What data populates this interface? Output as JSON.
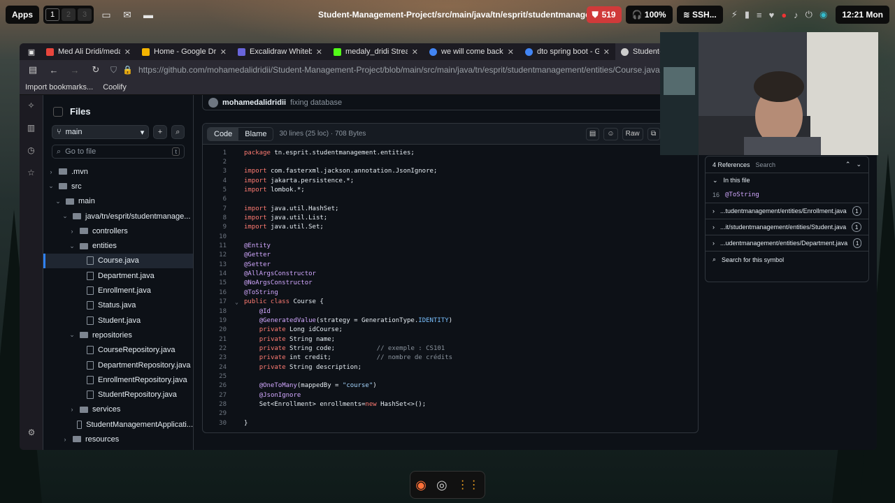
{
  "top_panel": {
    "apps_label": "Apps",
    "workspaces": [
      "1",
      "2",
      "3"
    ],
    "window_title": "Student-Management-Project/src/main/java/tn/esprit/studentmanage...",
    "notification_count": "519",
    "volume": "100%",
    "network": "SSH...",
    "clock": "12:21 Mon"
  },
  "tabs": [
    {
      "label": "Med Ali Dridi/medaly",
      "icon_color": "#e8453c"
    },
    {
      "label": "Home - Google Drive",
      "icon_color": "#f4b400"
    },
    {
      "label": "Excalidraw Whiteboa",
      "icon_color": "#6965db"
    },
    {
      "label": "medaly_dridi Stream",
      "icon_color": "#53fc18"
    },
    {
      "label": "we will come back - G",
      "icon_color": "#4285f4"
    },
    {
      "label": "dto spring boot - Goo",
      "icon_color": "#4285f4"
    },
    {
      "label": "Student-M",
      "icon_color": "#cccccc"
    }
  ],
  "url": "https://github.com/mohamedalidridii/Student-Management-Project/blob/main/src/main/java/tn/esprit/studentmanagement/entities/Course.java",
  "bookmarks": [
    "Import bookmarks...",
    "Coolify"
  ],
  "sidebar": {
    "title": "Files",
    "branch": "main",
    "goto_placeholder": "Go to file",
    "goto_shortcut": "t",
    "tree": [
      {
        "label": ".mvn",
        "type": "folder",
        "depth": 0,
        "state": "collapsed"
      },
      {
        "label": "src",
        "type": "folder",
        "depth": 0,
        "state": "expanded"
      },
      {
        "label": "main",
        "type": "folder",
        "depth": 1,
        "state": "expanded"
      },
      {
        "label": "java/tn/esprit/studentmanage...",
        "type": "folder",
        "depth": 2,
        "state": "expanded"
      },
      {
        "label": "controllers",
        "type": "folder",
        "depth": 3,
        "state": "collapsed"
      },
      {
        "label": "entities",
        "type": "folder",
        "depth": 3,
        "state": "expanded"
      },
      {
        "label": "Course.java",
        "type": "file",
        "depth": 4,
        "selected": true
      },
      {
        "label": "Department.java",
        "type": "file",
        "depth": 4
      },
      {
        "label": "Enrollment.java",
        "type": "file",
        "depth": 4
      },
      {
        "label": "Status.java",
        "type": "file",
        "depth": 4
      },
      {
        "label": "Student.java",
        "type": "file",
        "depth": 4
      },
      {
        "label": "repositories",
        "type": "folder",
        "depth": 3,
        "state": "expanded"
      },
      {
        "label": "CourseRepository.java",
        "type": "file",
        "depth": 4
      },
      {
        "label": "DepartmentRepository.java",
        "type": "file",
        "depth": 4
      },
      {
        "label": "EnrollmentRepository.java",
        "type": "file",
        "depth": 4
      },
      {
        "label": "StudentRepository.java",
        "type": "file",
        "depth": 4
      },
      {
        "label": "services",
        "type": "folder",
        "depth": 3,
        "state": "collapsed"
      },
      {
        "label": "StudentManagementApplicati...",
        "type": "file",
        "depth": 3
      },
      {
        "label": "resources",
        "type": "folder",
        "depth": 2,
        "state": "collapsed"
      }
    ]
  },
  "commit": {
    "author": "mohamedalidridii",
    "message": "fixing database"
  },
  "code_header": {
    "tab_code": "Code",
    "tab_blame": "Blame",
    "meta": "30 lines (25 loc) · 708 Bytes",
    "raw": "Raw"
  },
  "code_lines": [
    [
      [
        "k",
        "package "
      ],
      [
        "",
        "tn.esprit.studentmanagement.entities;"
      ]
    ],
    [],
    [
      [
        "k",
        "import "
      ],
      [
        "",
        "com.fasterxml.jackson.annotation.JsonIgnore;"
      ]
    ],
    [
      [
        "k",
        "import "
      ],
      [
        "",
        "jakarta.persistence.*;"
      ]
    ],
    [
      [
        "k",
        "import "
      ],
      [
        "",
        "lombok.*;"
      ]
    ],
    [],
    [
      [
        "k",
        "import "
      ],
      [
        "",
        "java.util.HashSet;"
      ]
    ],
    [
      [
        "k",
        "import "
      ],
      [
        "",
        "java.util.List;"
      ]
    ],
    [
      [
        "k",
        "import "
      ],
      [
        "",
        "java.util.Set;"
      ]
    ],
    [],
    [
      [
        "a",
        "@Entity"
      ]
    ],
    [
      [
        "a",
        "@Getter"
      ]
    ],
    [
      [
        "a",
        "@Setter"
      ]
    ],
    [
      [
        "a",
        "@AllArgsConstructor"
      ]
    ],
    [
      [
        "a",
        "@NoArgsConstructor"
      ]
    ],
    [
      [
        "a",
        "@ToString"
      ]
    ],
    [
      [
        "k",
        "public class "
      ],
      [
        "",
        "Course {"
      ]
    ],
    [
      [
        "",
        "    "
      ],
      [
        "a",
        "@Id"
      ]
    ],
    [
      [
        "",
        "    "
      ],
      [
        "a",
        "@GeneratedValue"
      ],
      [
        "",
        "(strategy = GenerationType."
      ],
      [
        "t",
        "IDENTITY"
      ],
      [
        "",
        ")"
      ]
    ],
    [
      [
        "",
        "    "
      ],
      [
        "k",
        "private "
      ],
      [
        "",
        "Long idCourse;"
      ]
    ],
    [
      [
        "",
        "    "
      ],
      [
        "k",
        "private "
      ],
      [
        "",
        "String name;"
      ]
    ],
    [
      [
        "",
        "    "
      ],
      [
        "k",
        "private "
      ],
      [
        "",
        "String code;           "
      ],
      [
        "c",
        "// exemple : CS101"
      ]
    ],
    [
      [
        "",
        "    "
      ],
      [
        "k",
        "private "
      ],
      [
        "",
        "int credit;            "
      ],
      [
        "c",
        "// nombre de crédits"
      ]
    ],
    [
      [
        "",
        "    "
      ],
      [
        "k",
        "private "
      ],
      [
        "",
        "String description;"
      ]
    ],
    [],
    [
      [
        "",
        "    "
      ],
      [
        "a",
        "@OneToMany"
      ],
      [
        "",
        "(mappedBy = "
      ],
      [
        "s",
        "\"course\""
      ],
      [
        "",
        ")"
      ]
    ],
    [
      [
        "",
        "    "
      ],
      [
        "a",
        "@JsonIgnore"
      ]
    ],
    [
      [
        "",
        "    "
      ],
      [
        "",
        "Set<Enrollment> enrollments="
      ],
      [
        "k",
        "new "
      ],
      [
        "",
        "HashSet<>();"
      ]
    ],
    [],
    [
      [
        "",
        "}"
      ]
    ]
  ],
  "references": {
    "title": "4 References",
    "search": "Search",
    "in_file_label": "In this file",
    "in_file_item": {
      "line": "16",
      "symbol": "@ToString"
    },
    "items": [
      {
        "path": "...tudentmanagement/entities/Enrollment.java",
        "count": "1"
      },
      {
        "path": "...it/studentmanagement/entities/Student.java",
        "count": "1"
      },
      {
        "path": "...udentmanagement/entities/Department.java",
        "count": "1"
      }
    ],
    "search_symbol": "Search for this symbol"
  }
}
